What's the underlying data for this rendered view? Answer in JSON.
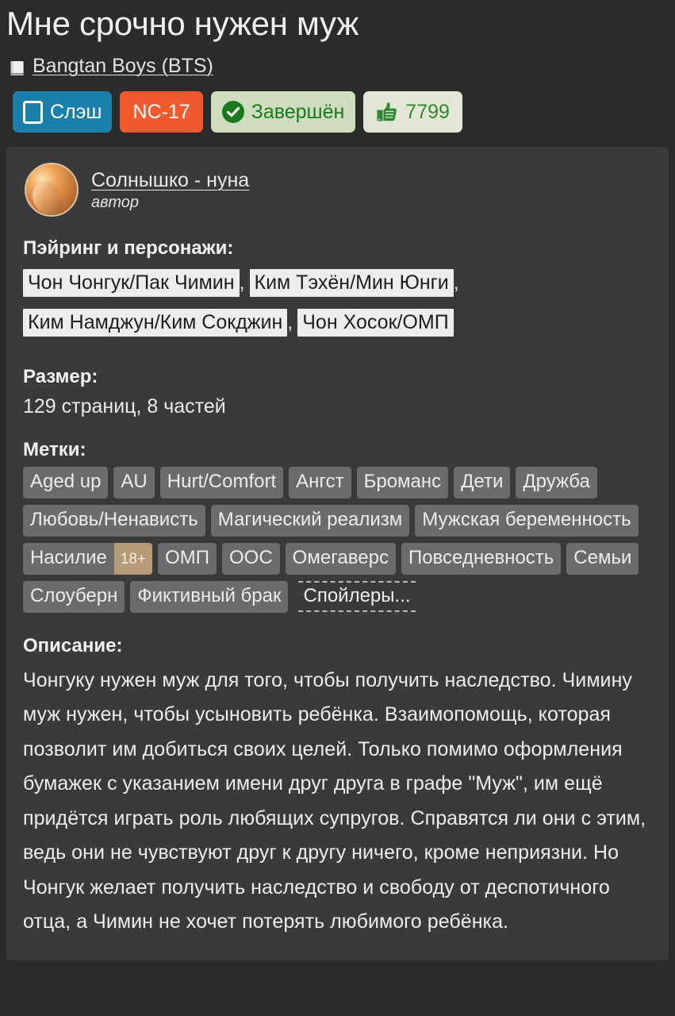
{
  "work": {
    "title": "Мне срочно нужен муж",
    "fandom": {
      "icon": "book-icon",
      "label": "Bangtan Boys (BTS)"
    },
    "badges": {
      "category": {
        "icon": "square-outline-icon",
        "label": "Слэш",
        "bg": "#1b7fab",
        "fg": "#ffffff"
      },
      "rating": {
        "label": "NC-17",
        "bg": "#f2592c",
        "fg": "#ffffff"
      },
      "status": {
        "icon": "check-circle-icon",
        "label": "Завершён",
        "bg": "#cfdcbf",
        "fg": "#1c7a1c"
      },
      "likes": {
        "icon": "thumbs-up-icon",
        "label": "7799",
        "bg": "#e3e6d5",
        "fg": "#2f8a36"
      }
    }
  },
  "author": {
    "avatar": "author-avatar",
    "name": "Солнышко - нуна",
    "role": "автор"
  },
  "pairings": {
    "heading": "Пэйринг и персонажи:",
    "items": [
      "Чон Чонгук/Пак Чимин",
      "Ким Тэхён/Мин Юнги",
      "Ким Намджун/Ким Сокджин",
      "Чон Хосок/ОМП"
    ],
    "separator": ","
  },
  "size": {
    "heading": "Размер:",
    "value": "129 страниц, 8 частей"
  },
  "tags": {
    "heading": "Метки:",
    "items": [
      {
        "label": "Aged up"
      },
      {
        "label": "AU"
      },
      {
        "label": "Hurt/Comfort"
      },
      {
        "label": "Ангст"
      },
      {
        "label": "Броманс"
      },
      {
        "label": "Дети"
      },
      {
        "label": "Дружба"
      },
      {
        "label": "Любовь/Ненависть"
      },
      {
        "label": "Магический реализм"
      },
      {
        "label": "Мужская беременность"
      },
      {
        "label": "Насилие",
        "suffix": "18+"
      },
      {
        "label": "ОМП"
      },
      {
        "label": "ООС"
      },
      {
        "label": "Омегаверс"
      },
      {
        "label": "Повседневность"
      },
      {
        "label": "Семьи"
      },
      {
        "label": "Слоуберн"
      },
      {
        "label": "Фиктивный брак"
      },
      {
        "label": "Спойлеры...",
        "style": "spoiler"
      }
    ]
  },
  "description": {
    "heading": "Описание:",
    "text": "Чонгуку нужен муж для того, чтобы получить наследство. Чимину муж нужен, чтобы усыновить ребёнка. Взаимопомощь, которая позволит им добиться своих целей. Только помимо оформления бумажек с указанием имени друг друга в графе \"Муж\", им ещё придётся играть роль любящих супругов. Справятся ли они с этим, ведь они не чувствуют друг к другу ничего, кроме неприязни. Но Чонгук желает получить наследство и свободу от деспотичного отца, а Чимин не хочет потерять любимого ребёнка."
  },
  "colors": {
    "page_bg": "#2b2b2b",
    "card_bg": "#3a3a3a",
    "tag_bg": "#6b6b6b",
    "pairing_bg": "#ededed",
    "text": "#ededed"
  }
}
